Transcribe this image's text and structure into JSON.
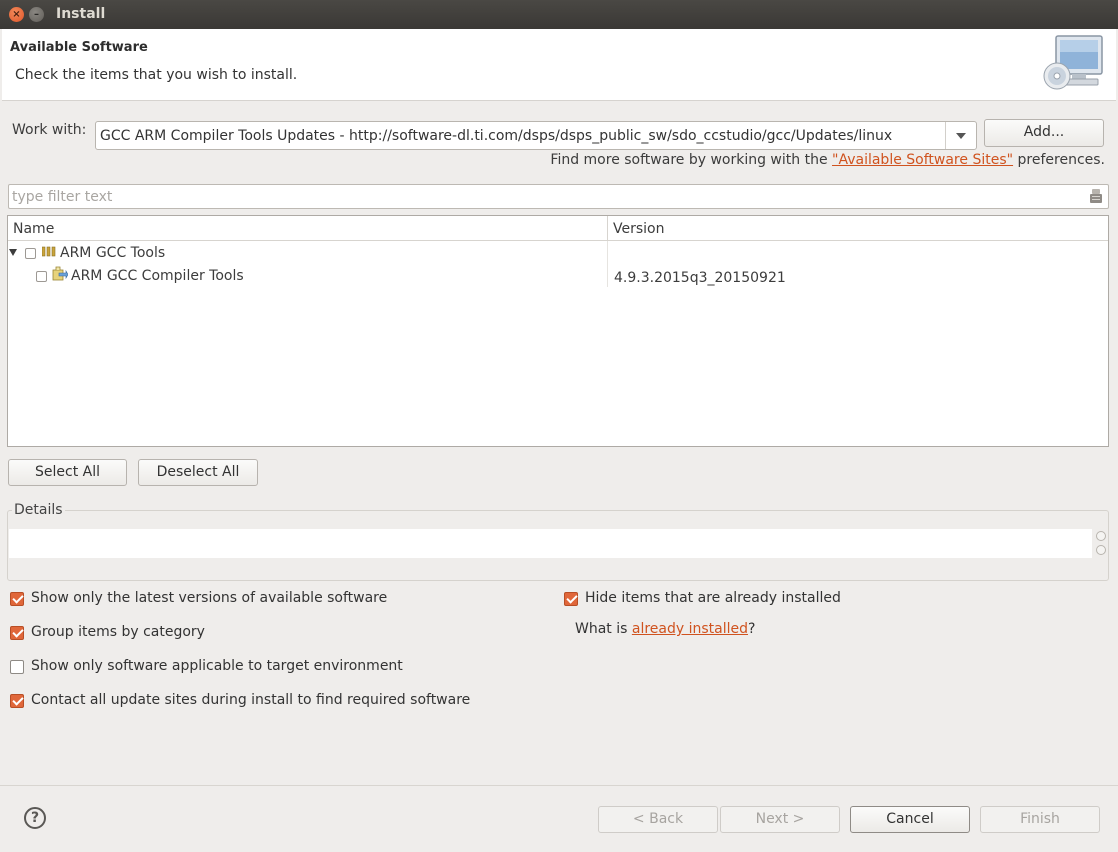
{
  "window": {
    "title": "Install"
  },
  "banner": {
    "heading": "Available Software",
    "subtitle": "Check the items that you wish to install."
  },
  "work_with": {
    "label": "Work with:",
    "value": "GCC ARM Compiler Tools Updates - http://software-dl.ti.com/dsps/dsps_public_sw/sdo_ccstudio/gcc/Updates/linux",
    "add_label": "Add...",
    "find_more_prefix": "Find more software by working with the ",
    "find_more_link": "\"Available Software Sites\"",
    "find_more_suffix": " preferences."
  },
  "filter": {
    "placeholder": "type filter text"
  },
  "tree": {
    "columns": {
      "name": "Name",
      "version": "Version"
    },
    "rows": [
      {
        "name": "ARM GCC Tools",
        "version": "",
        "checked": false,
        "expanded": true
      },
      {
        "name": "ARM GCC Compiler Tools",
        "version": "4.9.3.2015q3_20150921",
        "checked": false
      }
    ]
  },
  "selection": {
    "select_all": "Select All",
    "deselect_all": "Deselect All"
  },
  "details": {
    "label": "Details",
    "text": ""
  },
  "options": {
    "latest_only": {
      "label": "Show only the latest versions of available software",
      "checked": true
    },
    "group_by_category": {
      "label": "Group items by category",
      "checked": true
    },
    "target_env": {
      "label": "Show only software applicable to target environment",
      "checked": false
    },
    "contact_sites": {
      "label": "Contact all update sites during install to find required software",
      "checked": true
    },
    "hide_installed": {
      "label": "Hide items that are already installed",
      "checked": true
    },
    "what_is_prefix": "What is ",
    "already_installed_link": "already installed",
    "what_is_suffix": "?"
  },
  "footer": {
    "help": "?",
    "back": "< Back",
    "next": "Next >",
    "cancel": "Cancel",
    "finish": "Finish"
  },
  "colors": {
    "accent": "#e0673a",
    "link": "#d0531f"
  }
}
